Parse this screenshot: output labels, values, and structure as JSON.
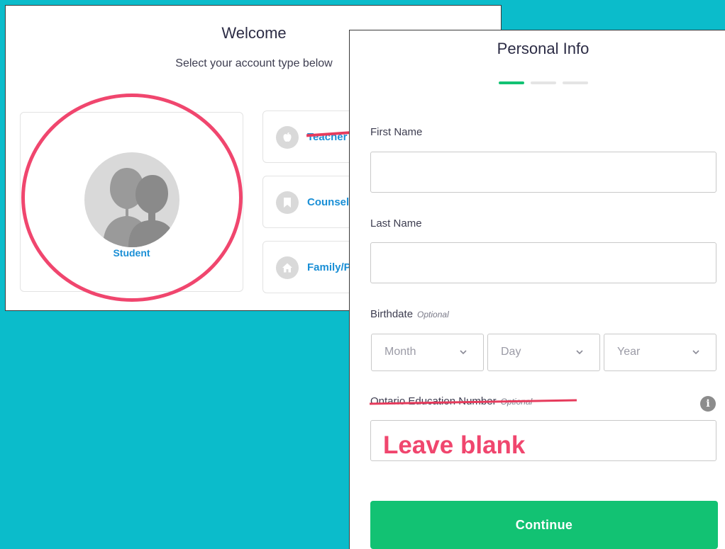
{
  "welcome": {
    "title": "Welcome",
    "subtitle": "Select your account type below",
    "student_label": "Student",
    "roles": [
      {
        "label": "Teacher",
        "icon": "apple-icon"
      },
      {
        "label": "Counselor",
        "icon": "bookmark-icon"
      },
      {
        "label": "Family/Parent",
        "icon": "home-icon"
      }
    ]
  },
  "personal_info": {
    "title": "Personal Info",
    "steps_total": 3,
    "steps_current": 1,
    "first_name": {
      "label": "First Name",
      "value": ""
    },
    "last_name": {
      "label": "Last Name",
      "value": ""
    },
    "birthdate": {
      "label": "Birthdate",
      "optional": "Optional",
      "month_placeholder": "Month",
      "day_placeholder": "Day",
      "year_placeholder": "Year"
    },
    "oen": {
      "label": "Ontario Education Number",
      "optional": "Optional",
      "annotation": "Leave blank"
    },
    "continue_label": "Continue"
  },
  "colors": {
    "background": "#0bbccb",
    "accent_green": "#12c273",
    "annotation_red": "#f0466e",
    "link_blue": "#1a8fd6",
    "step_inactive": "#e4e4e4"
  }
}
